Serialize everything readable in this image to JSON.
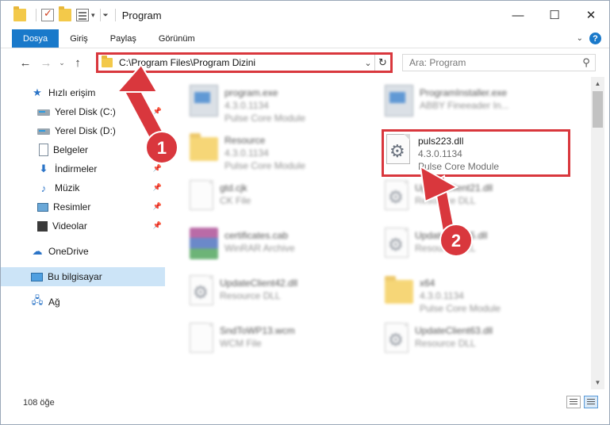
{
  "window": {
    "title": "Program",
    "minimize": "—",
    "maximize": "☐",
    "close": "✕"
  },
  "ribbon": {
    "tabs": [
      "Dosya",
      "Giriş",
      "Paylaş",
      "Görünüm"
    ]
  },
  "nav": {
    "back": "←",
    "forward": "→",
    "recent": "⌄",
    "up": "↑"
  },
  "address": {
    "path": "C:\\Program Files\\Program Dizini",
    "refresh": "↻"
  },
  "search": {
    "placeholder": "Ara: Program"
  },
  "sidebar": {
    "items": [
      {
        "label": "Hızlı erişim",
        "icon": "quick-access-star-icon"
      },
      {
        "label": "Yerel Disk (C:)",
        "icon": "disk-icon",
        "pinned": true
      },
      {
        "label": "Yerel Disk (D:)",
        "icon": "disk-icon",
        "pinned": true
      },
      {
        "label": "Belgeler",
        "icon": "documents-icon",
        "pinned": true
      },
      {
        "label": "İndirmeler",
        "icon": "download-icon",
        "pinned": true
      },
      {
        "label": "Müzik",
        "icon": "music-icon",
        "pinned": true
      },
      {
        "label": "Resimler",
        "icon": "pictures-icon",
        "pinned": true
      },
      {
        "label": "Videolar",
        "icon": "videos-icon",
        "pinned": true
      },
      {
        "label": "OneDrive",
        "icon": "cloud-icon"
      },
      {
        "label": "Bu bilgisayar",
        "icon": "computer-icon",
        "selected": true
      },
      {
        "label": "Ağ",
        "icon": "network-icon"
      }
    ]
  },
  "files": [
    {
      "name": "program.exe",
      "line2": "4.3.0.1134",
      "line3": "Pulse Core Module",
      "icon": "exe-icon"
    },
    {
      "name": "ProgramInstaller.exe",
      "line2": "ABBY Fineeader In...",
      "line3": "",
      "icon": "exe-icon"
    },
    {
      "name": "Resource",
      "line2": "4.3.0.1134",
      "line3": "Pulse Core Module",
      "icon": "folder-icon"
    },
    {
      "name": "puls223.dll",
      "line2": "4.3.0.1134",
      "line3": "Pulse Core Module",
      "icon": "dll-gear-icon"
    },
    {
      "name": "gtd.cjk",
      "line2": "CK File",
      "line3": "",
      "icon": "blank-file-icon"
    },
    {
      "name": "UpdateClient21.dll",
      "line2": "Resource DLL",
      "line3": "",
      "icon": "dll-gear-icon"
    },
    {
      "name": "certificates.cab",
      "line2": "WinRAR Archive",
      "line3": "",
      "icon": "archive-icon"
    },
    {
      "name": "UpdateClient5.dll",
      "line2": "Resource DLL",
      "line3": "",
      "icon": "dll-gear-icon"
    },
    {
      "name": "UpdateClient42.dll",
      "line2": "Resource DLL",
      "line3": "",
      "icon": "dll-gear-icon"
    },
    {
      "name": "x64",
      "line2": "4.3.0.1134",
      "line3": "Pulse Core Module",
      "icon": "folder-icon"
    },
    {
      "name": "SndToWP13.wcm",
      "line2": "WCM File",
      "line3": "",
      "icon": "blank-file-icon"
    },
    {
      "name": "UpdateClient63.dll",
      "line2": "Resource DLL",
      "line3": "",
      "icon": "dll-gear-icon"
    }
  ],
  "status": {
    "count": "108 öğe"
  },
  "annotations": {
    "step1": "1",
    "step2": "2",
    "color": "#d9373d"
  }
}
